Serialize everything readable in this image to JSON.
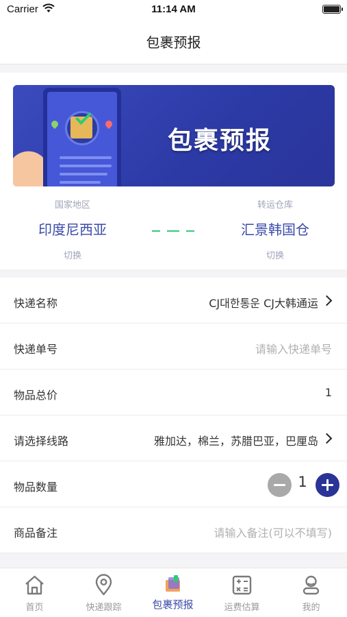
{
  "status_bar": {
    "carrier": "Carrier",
    "time": "11:14 AM"
  },
  "nav": {
    "title": "包裹预报"
  },
  "banner": {
    "title": "包裹预报"
  },
  "route": {
    "origin": {
      "label": "国家地区",
      "value": "印度尼西亚",
      "switch_label": "切换"
    },
    "destination": {
      "label": "转运仓库",
      "value": "汇景韩国仓",
      "switch_label": "切换"
    }
  },
  "form": {
    "courier": {
      "label": "快递名称",
      "value": "CJ대한통운   CJ大韩通运"
    },
    "tracking": {
      "label": "快递单号",
      "placeholder": "请输入快递单号"
    },
    "total_price": {
      "label": "物品总价",
      "value": "1"
    },
    "line": {
      "label": "请选择线路",
      "value": "雅加达，棉兰，苏腊巴亚，巴厘岛"
    },
    "quantity": {
      "label": "物品数量",
      "value": "1"
    },
    "remark": {
      "label": "商品备注",
      "placeholder": "请输入备注(可以不填写)"
    }
  },
  "tabs": [
    {
      "label": "首页",
      "icon": "home-icon",
      "active": false
    },
    {
      "label": "快递跟踪",
      "icon": "location-pin-icon",
      "active": false
    },
    {
      "label": "包裹预报",
      "icon": "package-icon",
      "active": true
    },
    {
      "label": "运费估算",
      "icon": "calculator-icon",
      "active": false
    },
    {
      "label": "我的",
      "icon": "profile-icon",
      "active": false
    }
  ],
  "colors": {
    "accent": "#3b4aa8",
    "dash": "#2ecc71",
    "stepper_plus": "#2a3396",
    "stepper_minus": "#a9a9a9"
  }
}
